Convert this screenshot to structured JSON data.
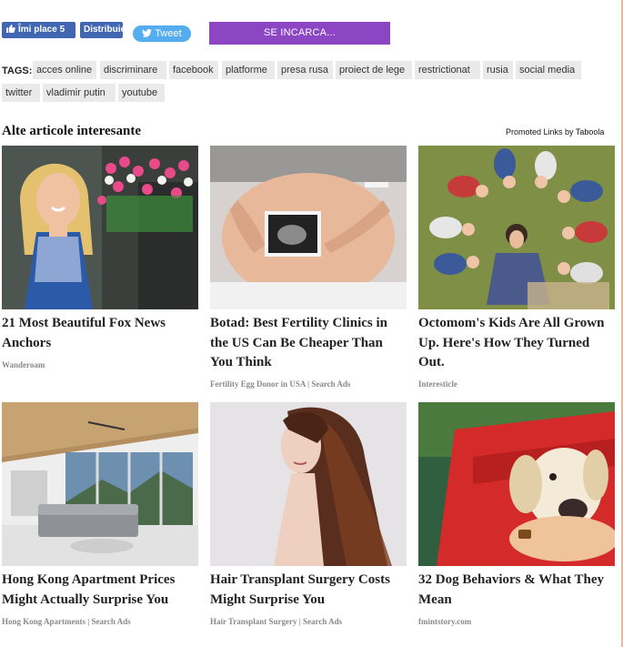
{
  "social": {
    "like_label": "Îmi place 5",
    "share_label": "Distribuie",
    "tweet_label": "Tweet",
    "load_label": "SE INCARCA..."
  },
  "tags": {
    "label": "TAGS:",
    "items": [
      "acces online",
      "discriminare",
      "facebook",
      "platforme",
      "presa rusa",
      "proiect de lege",
      "restrictionat",
      "rusia",
      "social media",
      "twitter",
      "vladimir putin",
      "youtube"
    ]
  },
  "recommendations": {
    "heading": "Alte articole interesante",
    "promoted": "Promoted Links by Taboola",
    "cards": [
      {
        "title": "21 Most Beautiful Fox News Anchors",
        "source": "Wanderoam"
      },
      {
        "title": "Botad: Best Fertility Clinics in the US Can Be Cheaper Than You Think",
        "source": "Fertility Egg Donor in USA | Search Ads"
      },
      {
        "title": "Octomom's Kids Are All Grown Up. Here's How They Turned Out.",
        "source": "Interesticle"
      },
      {
        "title": "Hong Kong Apartment Prices Might Actually Surprise You",
        "source": "Hong Kong Apartments | Search Ads"
      },
      {
        "title": "Hair Transplant Surgery Costs Might Surprise You",
        "source": "Hair Transplant Surgery | Search Ads"
      },
      {
        "title": "32 Dog Behaviors & What They Mean",
        "source": "fmintstory.com"
      }
    ]
  }
}
